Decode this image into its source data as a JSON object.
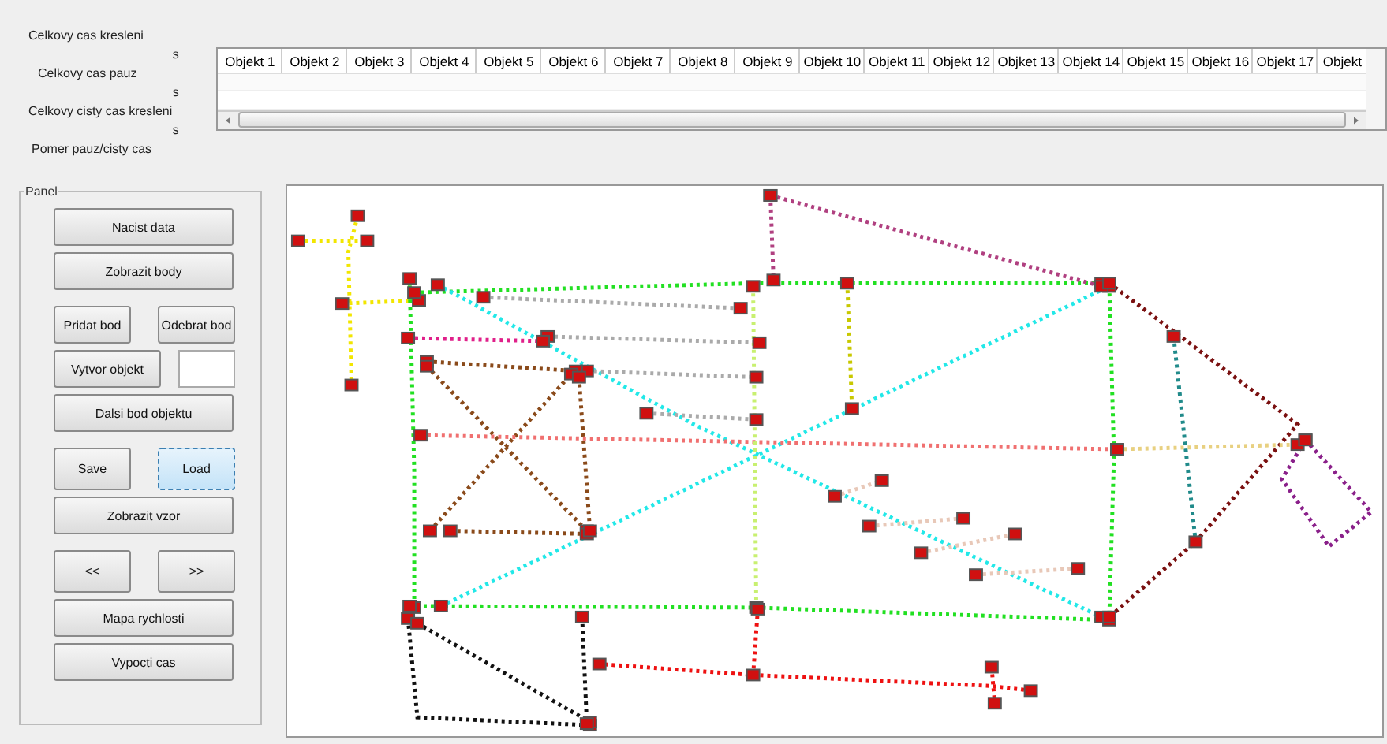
{
  "summary": [
    {
      "label": "Celkovy cas kresleni",
      "unit": "s"
    },
    {
      "label": "Celkovy cas pauz",
      "unit": "s"
    },
    {
      "label": "Celkovy cisty cas kresleni",
      "unit": "s"
    },
    {
      "label": "Pomer pauz/cisty cas"
    }
  ],
  "table": {
    "columns": [
      "Objekt 1",
      "Objekt 2",
      "Objekt 3",
      "Objekt 4",
      "Objekt 5",
      "Objekt 6",
      "Objekt 7",
      "Objekt 8",
      "Objekt 9",
      "Objekt 10",
      "Objekt 11",
      "Objekt 12",
      "Objket 13",
      "Objekt 14",
      "Objekt 15",
      "Objekt 16",
      "Objekt 17",
      "Objekt"
    ]
  },
  "panel": {
    "title": "Panel",
    "rows": [
      {
        "items": [
          {
            "kind": "button",
            "label": "Nacist data",
            "focused": false
          }
        ]
      },
      {
        "items": [
          {
            "kind": "button",
            "label": "Zobrazit body",
            "focused": false
          }
        ]
      },
      {
        "items": [
          {
            "kind": "button",
            "label": "Pridat bod",
            "focused": false
          },
          {
            "kind": "button",
            "label": "Odebrat bod",
            "focused": false
          }
        ]
      },
      {
        "items": [
          {
            "kind": "button",
            "label": "Vytvor objekt",
            "focused": false
          },
          {
            "kind": "field"
          }
        ]
      },
      {
        "items": [
          {
            "kind": "button",
            "label": "Dalsi bod objektu",
            "focused": false
          }
        ]
      },
      {
        "items": [
          {
            "kind": "button",
            "label": "Save",
            "focused": false
          },
          {
            "kind": "button",
            "label": "Load",
            "focused": true
          }
        ]
      },
      {
        "items": [
          {
            "kind": "button",
            "label": "Zobrazit vzor",
            "focused": false
          }
        ]
      },
      {
        "items": [
          {
            "kind": "button",
            "label": "<<",
            "focused": false
          },
          {
            "kind": "button",
            "label": ">>",
            "focused": false
          }
        ]
      },
      {
        "items": [
          {
            "kind": "button",
            "label": "Mapa rychlosti",
            "focused": false
          }
        ]
      },
      {
        "items": [
          {
            "kind": "button",
            "label": "Vypocti cas",
            "focused": false
          }
        ]
      }
    ]
  }
}
